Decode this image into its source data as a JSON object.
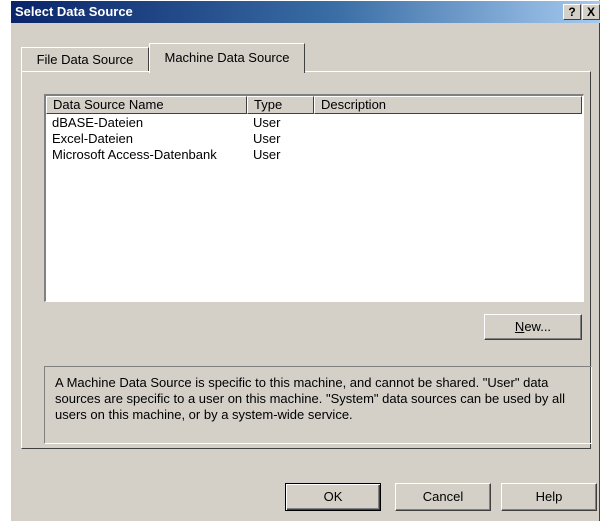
{
  "window": {
    "title": "Select Data Source",
    "help_button": "?",
    "close_button": "X"
  },
  "tabs": [
    {
      "label": "File Data Source",
      "selected": false
    },
    {
      "label": "Machine Data Source",
      "selected": true
    }
  ],
  "list": {
    "columns": [
      "Data Source Name",
      "Type",
      "Description"
    ],
    "rows": [
      {
        "name": "dBASE-Dateien",
        "type": "User",
        "description": ""
      },
      {
        "name": "Excel-Dateien",
        "type": "User",
        "description": ""
      },
      {
        "name": "Microsoft Access-Datenbank",
        "type": "User",
        "description": ""
      }
    ]
  },
  "new_button": {
    "mnemonic": "N",
    "rest": "ew..."
  },
  "info_text": "A Machine Data Source is specific to this machine, and cannot be shared. \"User\" data sources are specific to a user on this machine.  \"System\" data sources can be used by all users on this machine, or by a system-wide service.",
  "buttons": {
    "ok": "OK",
    "cancel": "Cancel",
    "help": "Help"
  }
}
